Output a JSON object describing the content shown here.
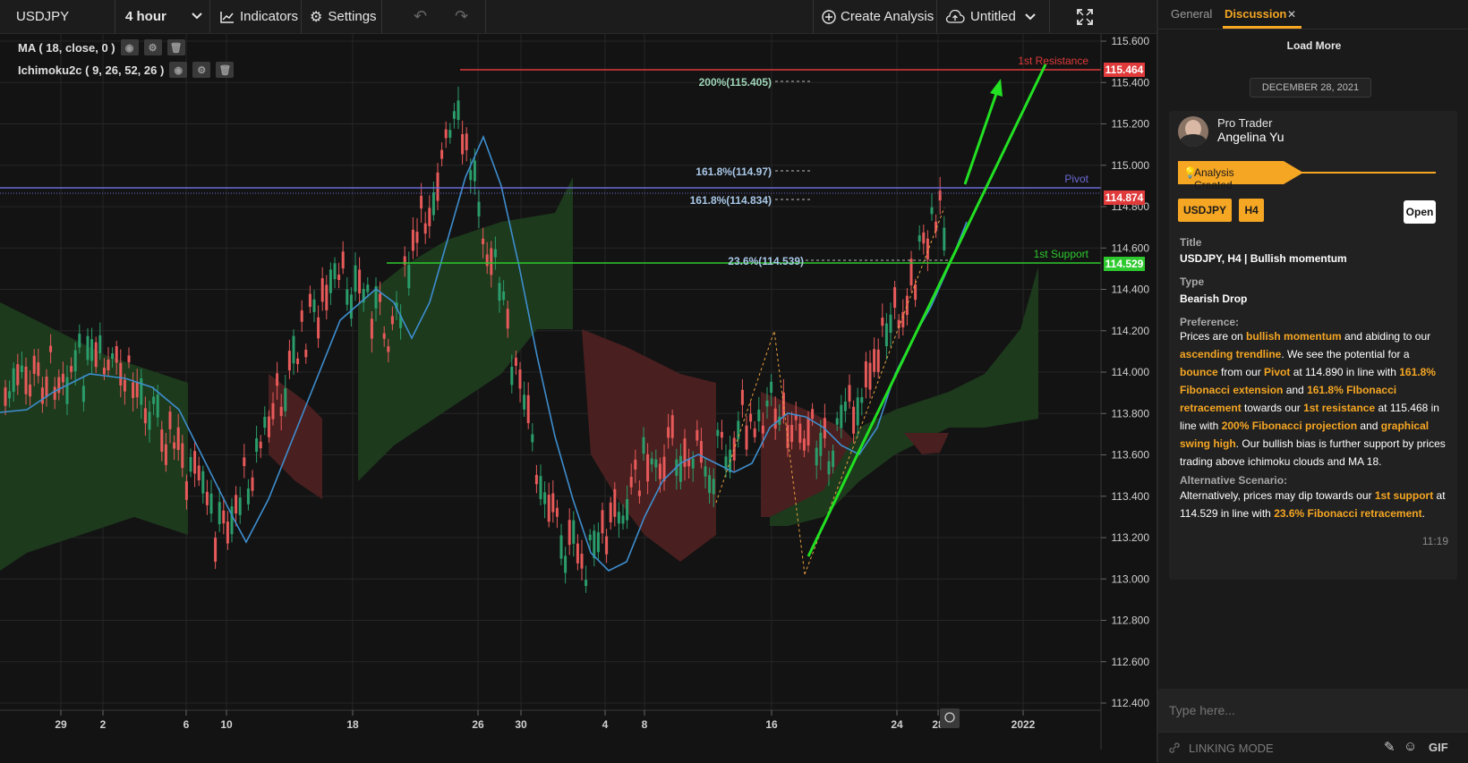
{
  "toolbar": {
    "symbol": "USDJPY",
    "timeframe": "4 hour",
    "indicators_label": "Indicators",
    "settings_label": "Settings",
    "create_analysis_label": "Create Analysis",
    "layout_name": "Untitled"
  },
  "legend": {
    "ma": "MA ( 18, close, 0 )",
    "ichimoku": "Ichimoku2c ( 9, 26, 52, 26 )"
  },
  "levels": {
    "resistance_label": "1st Resistance",
    "resistance_price": "115.464",
    "pivot_label": "Pivot",
    "pivot_price": "114.874",
    "support_label": "1st Support",
    "support_price": "114.529"
  },
  "fibs": {
    "f200": "200%(115.405)",
    "f161a": "161.8%(114.97)",
    "f161b": "161.8%(114.834)",
    "f236": "23.6%(114.539)"
  },
  "price_axis": [
    "115.600",
    "115.400",
    "115.200",
    "115.000",
    "114.800",
    "114.600",
    "114.400",
    "114.200",
    "114.000",
    "113.800",
    "113.600",
    "113.400",
    "113.200",
    "113.000",
    "112.800",
    "112.600",
    "112.400"
  ],
  "time_axis": [
    "29",
    "2",
    "6",
    "10",
    "18",
    "26",
    "30",
    "4",
    "8",
    "16",
    "24",
    "28",
    "2022"
  ],
  "colors": {
    "accent": "#f5a623",
    "resistance": "#e03a3a",
    "pivot": "#6b6bd6",
    "support": "#2ec92e",
    "trendline": "#22e022",
    "bull_candle": "#2a9d6a",
    "bear_candle": "#e85a5a",
    "ma_line": "#3e8ecf"
  },
  "sidebar": {
    "tab_general": "General",
    "tab_discussion": "Discussion",
    "load_more": "Load More",
    "date": "DECEMBER 28, 2021",
    "author_role": "Pro Trader",
    "author_name": "Angelina Yu",
    "analysis_created": "Analysis Created",
    "tag_symbol": "USDJPY",
    "tag_timeframe": "H4",
    "open_label": "Open",
    "title_label": "Title",
    "title_value": "USDJPY, H4 | Bullish momentum",
    "type_label": "Type",
    "type_value": "Bearish Drop",
    "preference_label": "Preference:",
    "pref": {
      "p01": "Prices are on ",
      "h01": "bullish momentum",
      "p02": " and abiding to our ",
      "h02": "ascending trendline",
      "p03": ". We see the potential for a ",
      "h03": "bounce",
      "p04": " from our ",
      "h04": "Pivot",
      "p05": " at 114.890 in line with ",
      "h05": "161.8% Fibonacci extension",
      "p06": " and ",
      "h06": "161.8% FIbonacci retracement",
      "p07": " towards our ",
      "h07": "1st resistance",
      "p08": " at 115.468 in line with ",
      "h08": "200% Fibonacci projection",
      "p09": " and ",
      "h09": "graphical swing high",
      "p10": ". Our bullish bias is further support by prices trading above ichimoku clouds and MA 18."
    },
    "alt_label": "Alternative Scenario:",
    "alt": {
      "p1": "Alternatively, prices may dip towards our ",
      "h1": "1st support",
      "p2": " at 114.529 in line with ",
      "h2": "23.6% Fibonacci retracement",
      "p3": "."
    },
    "time": "11:19",
    "composer_placeholder": "Type here...",
    "linking_mode": "LINKING MODE",
    "gif_label": "GIF"
  }
}
